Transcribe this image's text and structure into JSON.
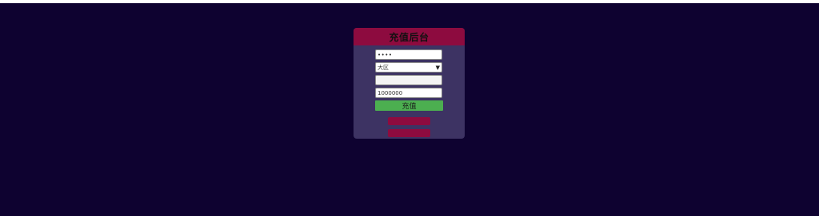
{
  "panel": {
    "title": "充值后台"
  },
  "form": {
    "password_value": "••••",
    "region_value": "大区",
    "account_value": "",
    "amount_value": "1000000",
    "submit_label": "充值"
  },
  "links": {
    "first_label": "",
    "second_label": ""
  },
  "colors": {
    "page_background": "#0e0230",
    "panel_background": "#3d3363",
    "header_background": "#8d0b3f",
    "submit_background": "#4caf50",
    "link_background": "#8d0b3f"
  }
}
